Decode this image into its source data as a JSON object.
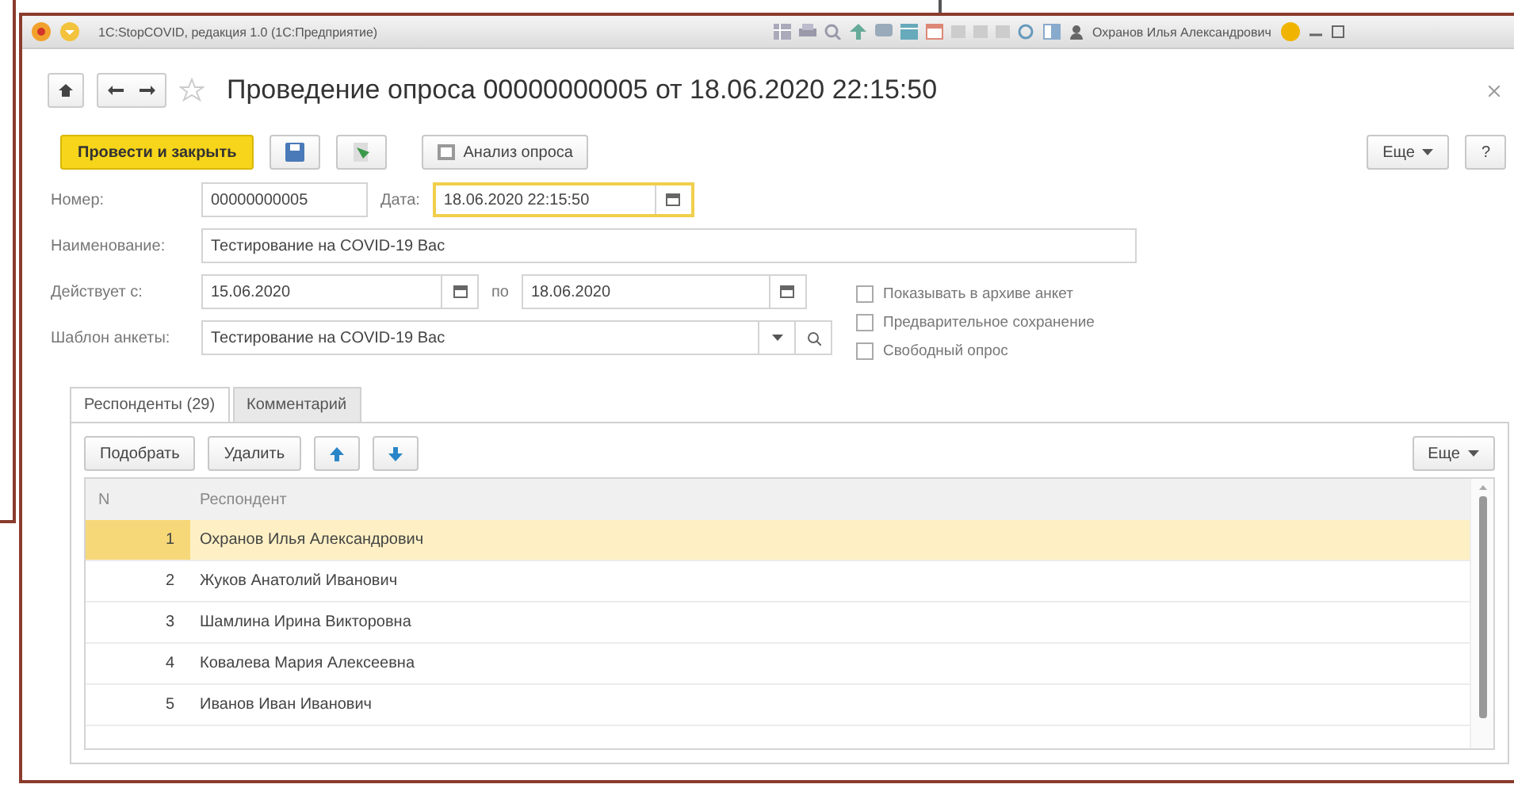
{
  "app": {
    "title": "1С:StopCOVID, редакция 1.0 (1С:Предприятие)",
    "user": "Охранов Илья Александрович"
  },
  "form": {
    "title": "Проведение опроса 00000000005 от 18.06.2020 22:15:50"
  },
  "toolbar": {
    "primary": "Провести и закрыть",
    "analysis": "Анализ опроса",
    "more": "Еще",
    "help": "?"
  },
  "number": {
    "label": "Номер:",
    "value": "00000000005"
  },
  "date": {
    "label": "Дата:",
    "value": "18.06.2020 22:15:50",
    "focused": true
  },
  "name": {
    "label": "Наименование:",
    "value": "Тестирование на COVID-19 Вас"
  },
  "period": {
    "label": "Действует с:",
    "from": "15.06.2020",
    "to_label": "по",
    "to": "18.06.2020"
  },
  "template": {
    "label": "Шаблон анкеты:",
    "value": "Тестирование на COVID-19 Вас"
  },
  "options": [
    {
      "label": "Показывать в архиве анкет",
      "checked": false
    },
    {
      "label": "Предварительное сохранение",
      "checked": false
    },
    {
      "label": "Свободный опрос",
      "checked": false
    }
  ],
  "tabs": [
    {
      "label": "Респонденты (29)",
      "selected": true
    },
    {
      "label": "Комментарий",
      "selected": false
    }
  ],
  "table_toolbar": {
    "pick": "Подобрать",
    "delete": "Удалить",
    "more": "Еще"
  },
  "table": {
    "columns": [
      "N",
      "Респондент"
    ],
    "rows": [
      {
        "n": "1",
        "name": "Охранов Илья Александрович",
        "selected": true
      },
      {
        "n": "2",
        "name": "Жуков Анатолий Иванович",
        "selected": false
      },
      {
        "n": "3",
        "name": "Шамлина Ирина Викторовна",
        "selected": false
      },
      {
        "n": "4",
        "name": "Ковалева Мария Алексеевна",
        "selected": false
      },
      {
        "n": "5",
        "name": "Иванов Иван Иванович",
        "selected": false
      }
    ]
  }
}
